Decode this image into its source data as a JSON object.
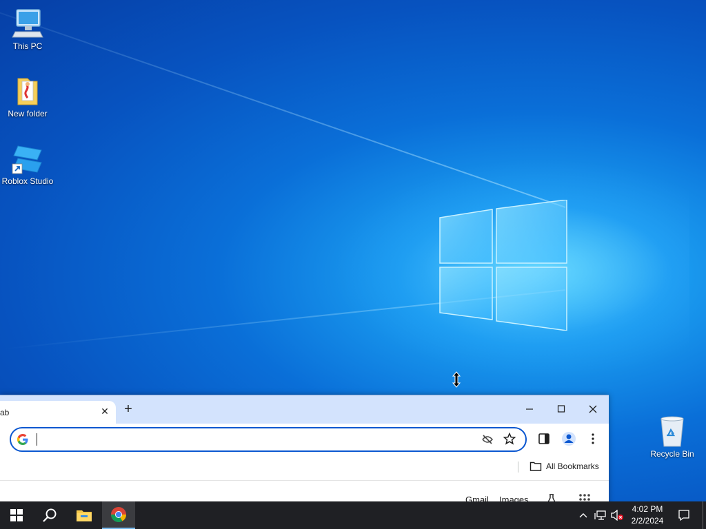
{
  "desktop": {
    "icons": [
      {
        "label": "This PC",
        "icon": "computer-icon"
      },
      {
        "label": "New folder",
        "icon": "folder-icon"
      },
      {
        "label": "Roblox Studio",
        "icon": "roblox-studio-icon"
      },
      {
        "label": "Recycle Bin",
        "icon": "recycle-bin-icon"
      }
    ],
    "wallpaper_accent": "#0a6fd8"
  },
  "browser": {
    "tab_title": "ab",
    "tab_close": "✕",
    "new_tab": "+",
    "window_controls": {
      "minimize": "—",
      "maximize": "☐",
      "close": "✕"
    },
    "omnibox": {
      "value": "",
      "placeholder": ""
    },
    "bookmarks": {
      "all_bookmarks": "All Bookmarks"
    },
    "page_links": {
      "gmail": "Gmail",
      "images": "Images"
    },
    "accent": "#0b57d0",
    "tabstrip_color": "#d3e3fd"
  },
  "taskbar": {
    "pinned": [
      "start-icon",
      "search-icon",
      "file-explorer-icon",
      "chrome-icon"
    ],
    "clock": {
      "time": "4:02 PM",
      "date": "2/2/2024"
    },
    "tray": [
      "chevron-up-icon",
      "network-icon",
      "volume-muted-icon",
      "notification-icon"
    ]
  }
}
